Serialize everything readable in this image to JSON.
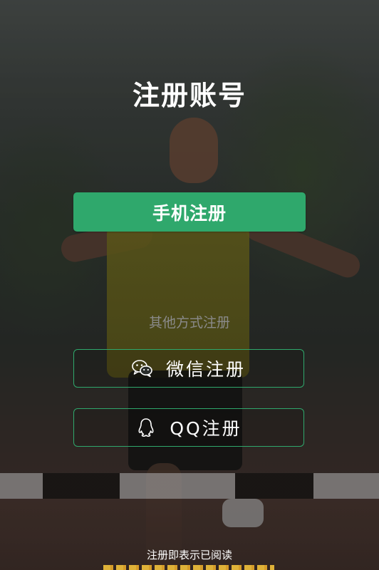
{
  "page": {
    "title": "注册账号"
  },
  "actions": {
    "phone_register": "手机注册",
    "other_methods_label": "其他方式注册",
    "wechat_register": "微信注册",
    "qq_register": "QQ注册"
  },
  "footer": {
    "notice": "注册即表示已阅读"
  },
  "icons": {
    "wechat": "wechat-icon",
    "qq": "qq-penguin-icon"
  },
  "colors": {
    "accent": "#2fa86c",
    "text_primary": "#ffffff",
    "text_muted": "#8a8a8a"
  }
}
